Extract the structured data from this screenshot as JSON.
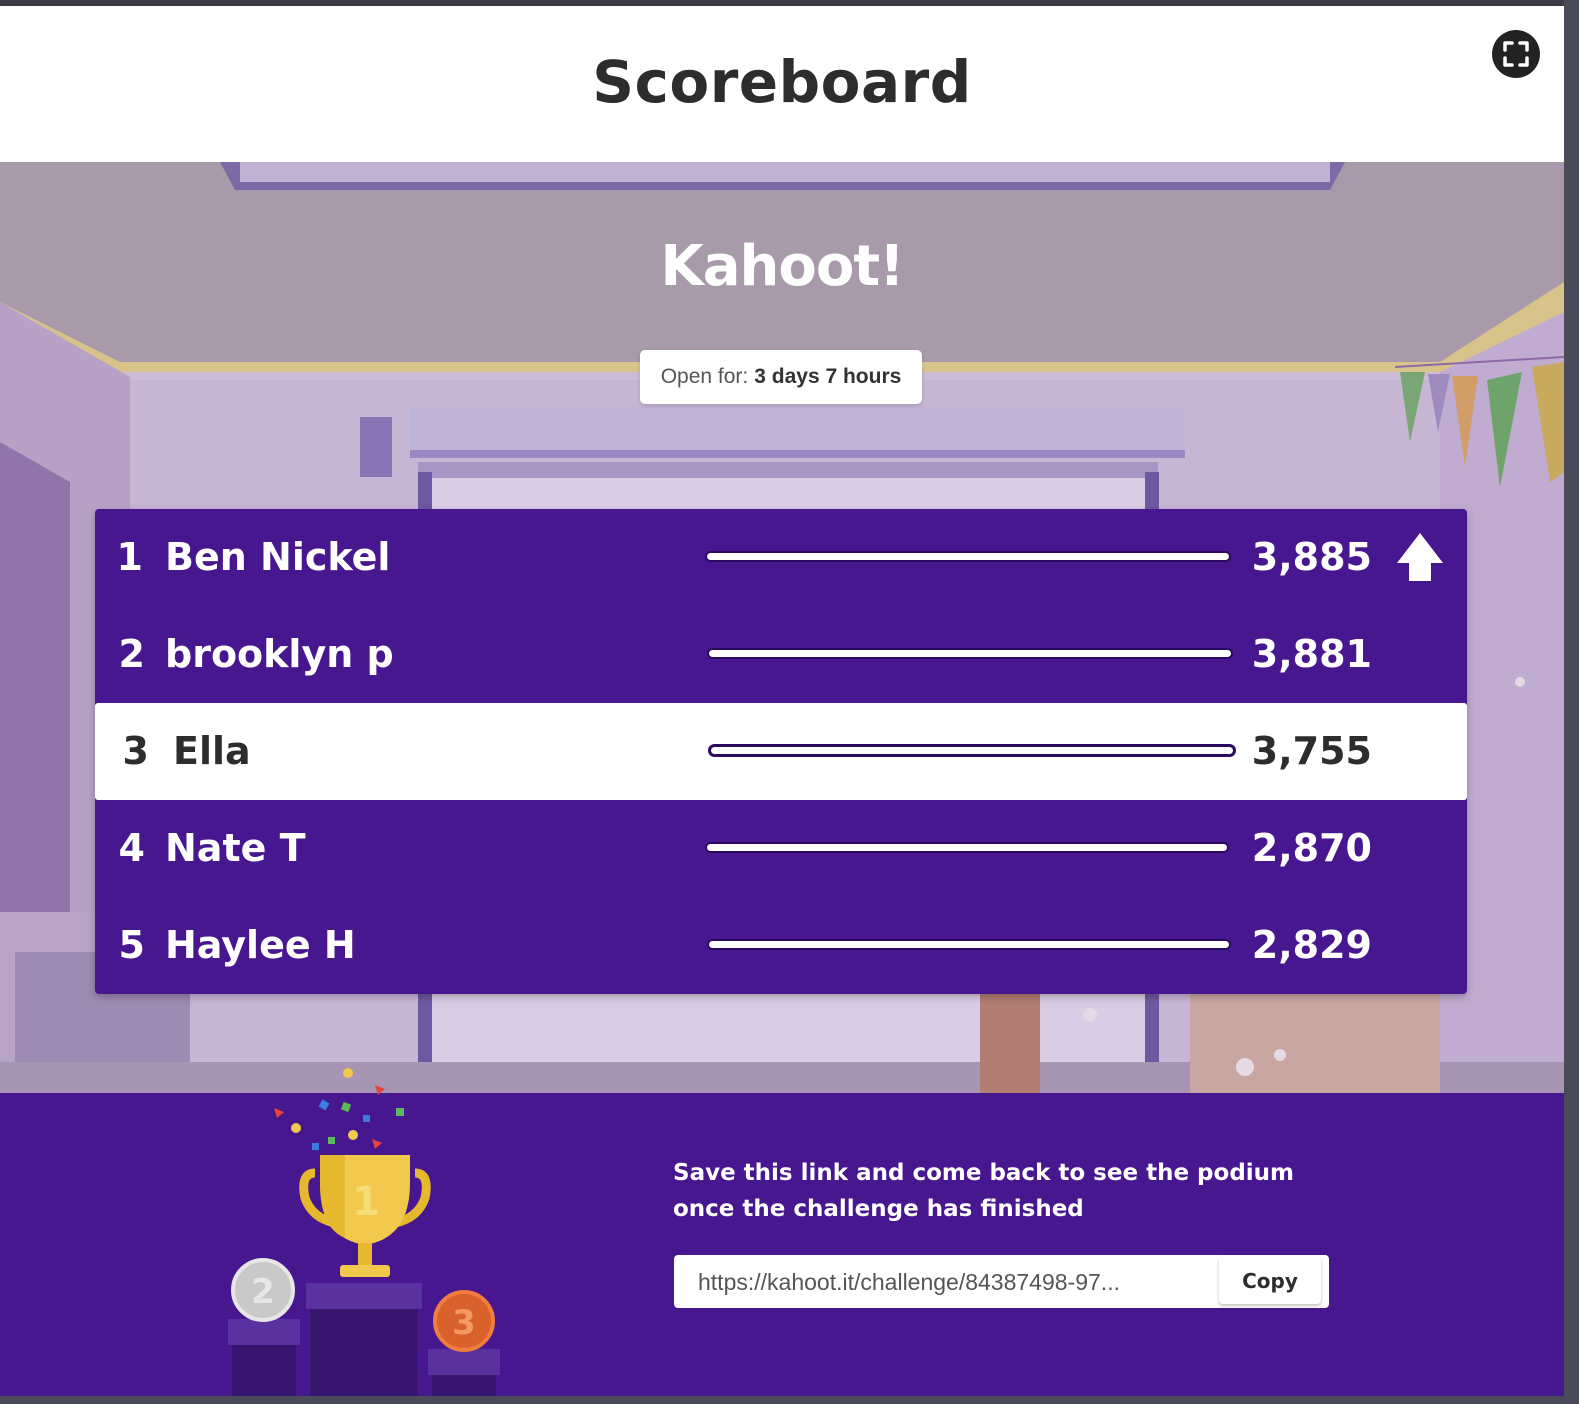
{
  "header": {
    "title": "Scoreboard",
    "fullscreen_icon": "fullscreen-icon"
  },
  "logo": {
    "text": "Kahoot!"
  },
  "open_for": {
    "label": "Open for:",
    "value": "3 days 7 hours"
  },
  "leaderboard": [
    {
      "rank": "1",
      "name": "Ben Nickel",
      "score": "3,885",
      "moved_up": true
    },
    {
      "rank": "2",
      "name": "brooklyn p",
      "score": "3,881"
    },
    {
      "rank": "3",
      "name": "Ella",
      "score": "3,755",
      "highlighted": true
    },
    {
      "rank": "4",
      "name": "Nate T",
      "score": "2,870"
    },
    {
      "rank": "5",
      "name": "Haylee H",
      "score": "2,829"
    }
  ],
  "footer": {
    "message_line1": "Save this link and come back to see the podium",
    "message_line2": "once the challenge has finished",
    "link_value": "https://kahoot.it/challenge/84387498-97...",
    "copy_label": "Copy",
    "podium": {
      "first": "1",
      "second": "2",
      "third": "3"
    }
  },
  "colors": {
    "brand_purple": "#46178f",
    "highlight_row": "#ffffff",
    "text_dark": "#2d2d2d"
  }
}
